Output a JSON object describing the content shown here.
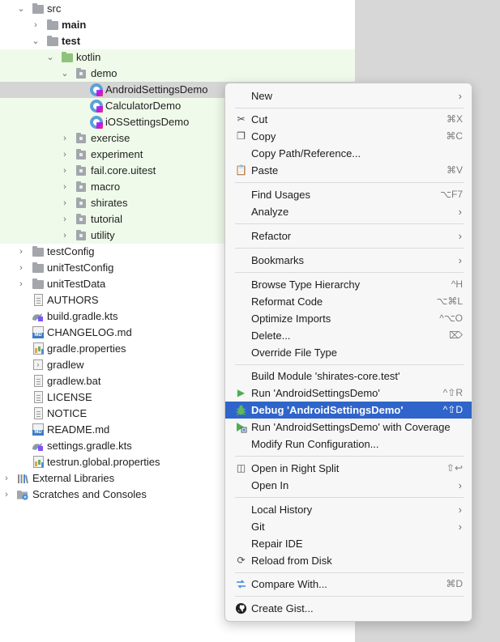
{
  "tree": {
    "rows": [
      {
        "label": "src"
      },
      {
        "label": "main"
      },
      {
        "label": "test"
      },
      {
        "label": "kotlin"
      },
      {
        "label": "demo"
      },
      {
        "label": "AndroidSettingsDemo"
      },
      {
        "label": "CalculatorDemo"
      },
      {
        "label": "iOSSettingsDemo"
      },
      {
        "label": "exercise"
      },
      {
        "label": "experiment"
      },
      {
        "label": "fail.core.uitest"
      },
      {
        "label": "macro"
      },
      {
        "label": "shirates"
      },
      {
        "label": "tutorial"
      },
      {
        "label": "utility"
      },
      {
        "label": "testConfig"
      },
      {
        "label": "unitTestConfig"
      },
      {
        "label": "unitTestData"
      },
      {
        "label": "AUTHORS"
      },
      {
        "label": "build.gradle.kts"
      },
      {
        "label": "CHANGELOG.md"
      },
      {
        "label": "gradle.properties"
      },
      {
        "label": "gradlew"
      },
      {
        "label": "gradlew.bat"
      },
      {
        "label": "LICENSE"
      },
      {
        "label": "NOTICE"
      },
      {
        "label": "README.md"
      },
      {
        "label": "settings.gradle.kts"
      },
      {
        "label": "testrun.global.properties"
      },
      {
        "label": "External Libraries"
      },
      {
        "label": "Scratches and Consoles"
      }
    ],
    "md_badge": "MD"
  },
  "menu": {
    "items": [
      {
        "label": "New",
        "shortcut": ""
      },
      {
        "label": "Cut",
        "shortcut": "⌘X"
      },
      {
        "label": "Copy",
        "shortcut": "⌘C"
      },
      {
        "label": "Copy Path/Reference...",
        "shortcut": ""
      },
      {
        "label": "Paste",
        "shortcut": "⌘V"
      },
      {
        "label": "Find Usages",
        "shortcut": "⌥F7"
      },
      {
        "label": "Analyze",
        "shortcut": ""
      },
      {
        "label": "Refactor",
        "shortcut": ""
      },
      {
        "label": "Bookmarks",
        "shortcut": ""
      },
      {
        "label": "Browse Type Hierarchy",
        "shortcut": "^H"
      },
      {
        "label": "Reformat Code",
        "shortcut": "⌥⌘L"
      },
      {
        "label": "Optimize Imports",
        "shortcut": "^⌥O"
      },
      {
        "label": "Delete...",
        "shortcut": "⌦"
      },
      {
        "label": "Override File Type",
        "shortcut": ""
      },
      {
        "label": "Build Module 'shirates-core.test'",
        "shortcut": ""
      },
      {
        "label": "Run 'AndroidSettingsDemo'",
        "shortcut": "^⇧R"
      },
      {
        "label": "Debug 'AndroidSettingsDemo'",
        "shortcut": "^⇧D"
      },
      {
        "label": "Run 'AndroidSettingsDemo' with Coverage",
        "shortcut": ""
      },
      {
        "label": "Modify Run Configuration...",
        "shortcut": ""
      },
      {
        "label": "Open in Right Split",
        "shortcut": "⇧↩"
      },
      {
        "label": "Open In",
        "shortcut": ""
      },
      {
        "label": "Local History",
        "shortcut": ""
      },
      {
        "label": "Git",
        "shortcut": ""
      },
      {
        "label": "Repair IDE",
        "shortcut": ""
      },
      {
        "label": "Reload from Disk",
        "shortcut": ""
      },
      {
        "label": "Compare With...",
        "shortcut": "⌘D"
      },
      {
        "label": "Create Gist...",
        "shortcut": ""
      }
    ]
  },
  "colors": {
    "highlight": "#2f65ca",
    "tree_test_bg": "#effaea",
    "tree_selected_bg": "#d5d5d5",
    "run_green": "#4caf50"
  }
}
